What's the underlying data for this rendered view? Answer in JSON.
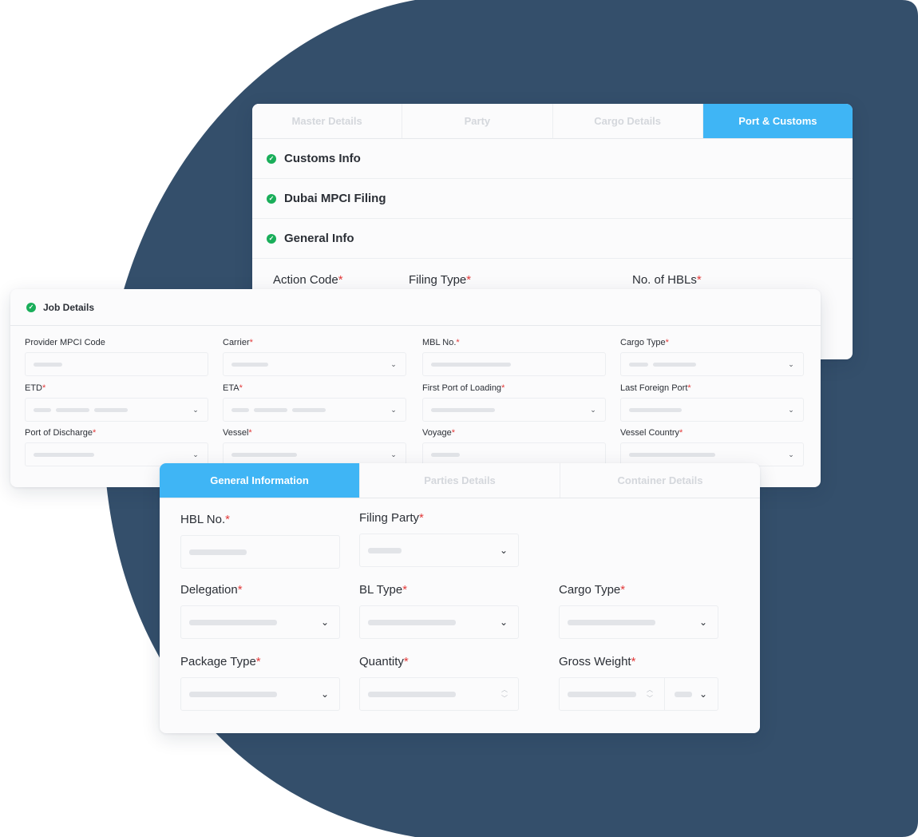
{
  "colors": {
    "backdrop": "#344f6b",
    "tab_active": "#3fb5f5",
    "check": "#1aae5a",
    "required": "#e23a3a"
  },
  "port_customs": {
    "tabs": [
      "Master Details",
      "Party",
      "Cargo Details",
      "Port & Customs"
    ],
    "active_tab": "Port & Customs",
    "sections": [
      "Customs Info",
      "Dubai MPCI Filing",
      "General Info"
    ],
    "fields": [
      {
        "label": "Action Code",
        "required": "*"
      },
      {
        "label": "Filing Type",
        "required": "*"
      },
      {
        "label": "No. of HBLs",
        "required": "*"
      }
    ]
  },
  "job_details": {
    "title": "Job Details",
    "fields": [
      {
        "label": "Provider MPCI Code",
        "required": "",
        "type": "text"
      },
      {
        "label": "Carrier",
        "required": "*",
        "type": "select"
      },
      {
        "label": "MBL No.",
        "required": "*",
        "type": "text"
      },
      {
        "label": "Cargo Type",
        "required": "*",
        "type": "select"
      },
      {
        "label": "ETD",
        "required": "*",
        "type": "select"
      },
      {
        "label": "ETA",
        "required": "*",
        "type": "select"
      },
      {
        "label": "First Port of Loading",
        "required": "*",
        "type": "select"
      },
      {
        "label": "Last Foreign Port",
        "required": "*",
        "type": "select"
      },
      {
        "label": "Port of Discharge",
        "required": "*",
        "type": "select"
      },
      {
        "label": "Vessel",
        "required": "*",
        "type": "select"
      },
      {
        "label": "Voyage",
        "required": "*",
        "type": "text"
      },
      {
        "label": "Vessel Country",
        "required": "*",
        "type": "select"
      }
    ]
  },
  "hbl_form": {
    "tabs": [
      "General Information",
      "Parties Details",
      "Container Details"
    ],
    "active_tab": "General Information",
    "fields": [
      {
        "label": "HBL No.",
        "required": "*",
        "type": "text"
      },
      {
        "label": "Filing Party",
        "required": "*",
        "type": "select"
      },
      {
        "label": "Delegation",
        "required": "*",
        "type": "select"
      },
      {
        "label": "BL Type",
        "required": "*",
        "type": "select"
      },
      {
        "label": "Cargo Type",
        "required": "*",
        "type": "select"
      },
      {
        "label": "Package Type",
        "required": "*",
        "type": "select"
      },
      {
        "label": "Quantity",
        "required": "*",
        "type": "number"
      },
      {
        "label": "Gross Weight",
        "required": "*",
        "type": "number-unit"
      }
    ]
  }
}
